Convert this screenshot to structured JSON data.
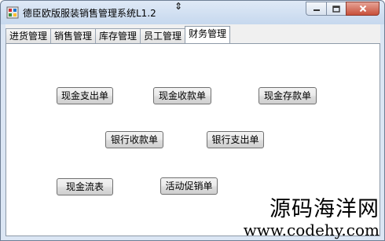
{
  "window": {
    "title": "德臣欧版服装销售管理系统L1.2",
    "cursor_glyph": "⇕"
  },
  "tabs": [
    {
      "label": "进货管理",
      "active": false
    },
    {
      "label": "销售管理",
      "active": false
    },
    {
      "label": "库存管理",
      "active": false
    },
    {
      "label": "员工管理",
      "active": false
    },
    {
      "label": "财务管理",
      "active": true
    }
  ],
  "buttons": {
    "cash_payment": "现金支出单",
    "cash_receipt": "现金收款单",
    "cash_deposit": "现金存款单",
    "bank_receipt": "银行收款单",
    "bank_payment": "银行支出单",
    "cash_flow": "现金流表",
    "promotion": "活动促销单"
  },
  "watermark": {
    "line1": "源码海洋网",
    "line2": "www.codehy.com"
  }
}
